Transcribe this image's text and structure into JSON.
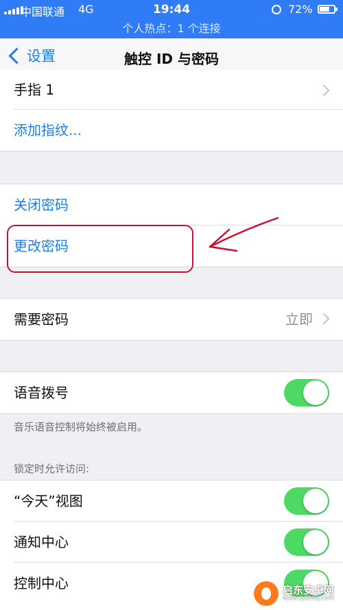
{
  "status": {
    "carrier": "中国联通",
    "network": "4G",
    "time": "19:44",
    "battery": "72%",
    "battery_level": 0.72,
    "hotspot": "个人热点：1 个连接"
  },
  "nav": {
    "back_label": "设置",
    "title": "触控 ID 与密码"
  },
  "fingerprints": {
    "finger1": "手指 1",
    "add": "添加指纹..."
  },
  "passcode": {
    "turn_off": "关闭密码",
    "change": "更改密码"
  },
  "require": {
    "label": "需要密码",
    "value": "立即"
  },
  "voice_dial": {
    "label": "语音拨号",
    "on": true,
    "note": "音乐语音控制将始终被启用。"
  },
  "lock_access": {
    "header": "锁定时允许访问:",
    "items": [
      {
        "label": "“今天”视图",
        "on": true
      },
      {
        "label": "通知中心",
        "on": true
      },
      {
        "label": "控制中心",
        "on": true
      }
    ]
  },
  "watermark": {
    "brand": "启东安卓网",
    "url": "www.qdltdq.com"
  },
  "colors": {
    "accent": "#1a7ef2",
    "toggle_on": "#4cd964",
    "status_bar": "#2f7cf6",
    "annotation": "#c8102e"
  }
}
